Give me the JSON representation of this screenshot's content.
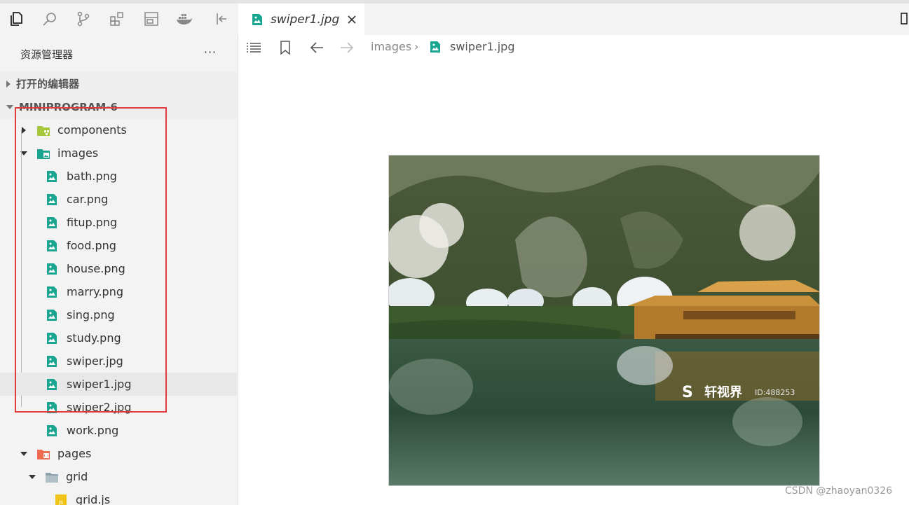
{
  "activity_bar": {
    "icons": [
      "files-icon",
      "search-icon",
      "source-control-icon",
      "extensions-icon",
      "layout-icon",
      "docker-icon",
      "collapse-panel-icon"
    ]
  },
  "sidebar": {
    "title": "资源管理器",
    "more_label": "···",
    "sections": {
      "open_editors": "打开的编辑器",
      "project": "MINIPROGRAM-6"
    },
    "tree": [
      {
        "label": "components",
        "type": "folder",
        "expanded": false
      },
      {
        "label": "images",
        "type": "folder",
        "expanded": true
      },
      {
        "label": "bath.png",
        "type": "image"
      },
      {
        "label": "car.png",
        "type": "image"
      },
      {
        "label": "fitup.png",
        "type": "image"
      },
      {
        "label": "food.png",
        "type": "image"
      },
      {
        "label": "house.png",
        "type": "image"
      },
      {
        "label": "marry.png",
        "type": "image"
      },
      {
        "label": "sing.png",
        "type": "image"
      },
      {
        "label": "study.png",
        "type": "image"
      },
      {
        "label": "swiper.jpg",
        "type": "image"
      },
      {
        "label": "swiper1.jpg",
        "type": "image",
        "selected": true
      },
      {
        "label": "swiper2.jpg",
        "type": "image"
      },
      {
        "label": "work.png",
        "type": "image"
      },
      {
        "label": "pages",
        "type": "folder",
        "expanded": true
      },
      {
        "label": "grid",
        "type": "folder",
        "expanded": true
      },
      {
        "label": "grid.js",
        "type": "js"
      }
    ]
  },
  "editor": {
    "tab": {
      "label": "swiper1.jpg"
    },
    "breadcrumb": {
      "folder": "images",
      "separator": "›",
      "file": "swiper1.jpg"
    },
    "preview": {
      "logo_text": "轩视界",
      "id_text": "ID:488253"
    }
  },
  "watermark": "CSDN @zhaoyan0326",
  "colors": {
    "image_icon": "#1aa591",
    "highlight_box": "#e03c3c",
    "components_folder": "#a6c63c",
    "pages_folder": "#ef6b4f",
    "js_icon": "#f0c419"
  }
}
